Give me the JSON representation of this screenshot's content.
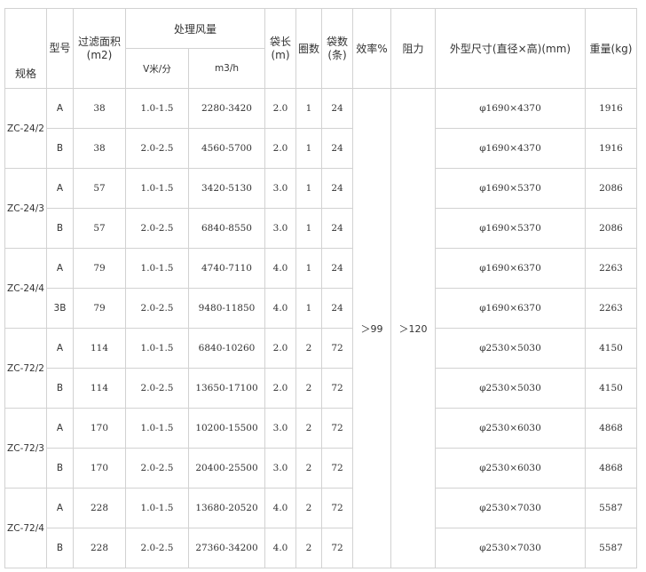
{
  "headers": {
    "spec": "规格",
    "type": "型号",
    "filter_area": "过滤面积",
    "filter_area_unit": "(m2)",
    "airflow": "处理风量",
    "velocity": "V米/分",
    "volume": "m3/h",
    "bag_length": "袋长",
    "bag_length_unit": "(m)",
    "rings": "圈数",
    "bag_count": "袋数",
    "bag_count_unit": "(条)",
    "efficiency": "效率%",
    "resistance": "阻力",
    "dimensions": "外型尺寸(直径×高)(mm)",
    "weight": "重量(kg)"
  },
  "merged": {
    "efficiency": "＞99",
    "resistance": "＞120"
  },
  "groups": [
    {
      "spec": "ZC-24/2",
      "rows": [
        {
          "type": "A",
          "area": "38",
          "v": "1.0-1.5",
          "flow": "2280-3420",
          "len": "2.0",
          "rings": "1",
          "bags": "24",
          "dim": "φ1690×4370",
          "weight": "1916"
        },
        {
          "type": "B",
          "area": "38",
          "v": "2.0-2.5",
          "flow": "4560-5700",
          "len": "2.0",
          "rings": "1",
          "bags": "24",
          "dim": "φ1690×4370",
          "weight": "1916"
        }
      ]
    },
    {
      "spec": "ZC-24/3",
      "rows": [
        {
          "type": "A",
          "area": "57",
          "v": "1.0-1.5",
          "flow": "3420-5130",
          "len": "3.0",
          "rings": "1",
          "bags": "24",
          "dim": "φ1690×5370",
          "weight": "2086"
        },
        {
          "type": "B",
          "area": "57",
          "v": "2.0-2.5",
          "flow": "6840-8550",
          "len": "3.0",
          "rings": "1",
          "bags": "24",
          "dim": "φ1690×5370",
          "weight": "2086"
        }
      ]
    },
    {
      "spec": "ZC-24/4",
      "rows": [
        {
          "type": "A",
          "area": "79",
          "v": "1.0-1.5",
          "flow": "4740-7110",
          "len": "4.0",
          "rings": "1",
          "bags": "24",
          "dim": "φ1690×6370",
          "weight": "2263"
        },
        {
          "type": "3B",
          "area": "79",
          "v": "2.0-2.5",
          "flow": "9480-11850",
          "len": "4.0",
          "rings": "1",
          "bags": "24",
          "dim": "φ1690×6370",
          "weight": "2263"
        }
      ]
    },
    {
      "spec": "ZC-72/2",
      "rows": [
        {
          "type": "A",
          "area": "114",
          "v": "1.0-1.5",
          "flow": "6840-10260",
          "len": "2.0",
          "rings": "2",
          "bags": "72",
          "dim": "φ2530×5030",
          "weight": "4150"
        },
        {
          "type": "B",
          "area": "114",
          "v": "2.0-2.5",
          "flow": "13650-17100",
          "len": "2.0",
          "rings": "2",
          "bags": "72",
          "dim": "φ2530×5030",
          "weight": "4150"
        }
      ]
    },
    {
      "spec": "ZC-72/3",
      "rows": [
        {
          "type": "A",
          "area": "170",
          "v": "1.0-1.5",
          "flow": "10200-15500",
          "len": "3.0",
          "rings": "2",
          "bags": "72",
          "dim": "φ2530×6030",
          "weight": "4868"
        },
        {
          "type": "B",
          "area": "170",
          "v": "2.0-2.5",
          "flow": "20400-25500",
          "len": "3.0",
          "rings": "2",
          "bags": "72",
          "dim": "φ2530×6030",
          "weight": "4868"
        }
      ]
    },
    {
      "spec": "ZC-72/4",
      "rows": [
        {
          "type": "A",
          "area": "228",
          "v": "1.0-1.5",
          "flow": "13680-20520",
          "len": "4.0",
          "rings": "2",
          "bags": "72",
          "dim": "φ2530×7030",
          "weight": "5587"
        },
        {
          "type": "B",
          "area": "228",
          "v": "2.0-2.5",
          "flow": "27360-34200",
          "len": "4.0",
          "rings": "2",
          "bags": "72",
          "dim": "φ2530×7030",
          "weight": "5587"
        }
      ]
    }
  ]
}
